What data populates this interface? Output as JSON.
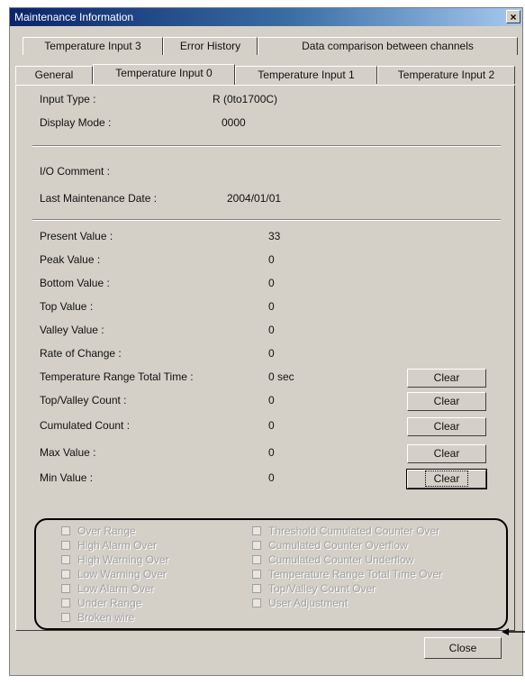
{
  "window": {
    "title": "Maintenance Information",
    "close_glyph": "×"
  },
  "tabs_back": [
    "Temperature Input 3",
    "Error History",
    "Data comparison between channels"
  ],
  "tabs_front": [
    "General",
    "Temperature Input 0",
    "Temperature Input 1",
    "Temperature Input 2"
  ],
  "active_tab": "Temperature Input 0",
  "info": {
    "input_type_label": "Input Type :",
    "input_type_value": "R (0to1700C)",
    "display_mode_label": "Display Mode :",
    "display_mode_value": "0000",
    "io_comment_label": "I/O Comment :",
    "last_maint_label": "Last Maintenance Date :",
    "last_maint_value": "2004/01/01"
  },
  "values": [
    {
      "label": "Present Value :",
      "value": "33"
    },
    {
      "label": "Peak Value :",
      "value": "0"
    },
    {
      "label": "Bottom Value :",
      "value": "0"
    },
    {
      "label": "Top Value :",
      "value": "0"
    },
    {
      "label": "Valley Value :",
      "value": "0"
    },
    {
      "label": "Rate of Change :",
      "value": "0"
    },
    {
      "label": "Temperature Range Total Time :",
      "value": "0 sec"
    },
    {
      "label": "Top/Valley Count :",
      "value": "0"
    },
    {
      "label": "Cumulated Count :",
      "value": "0"
    },
    {
      "label": "Max Value :",
      "value": "0"
    },
    {
      "label": "Min Value :",
      "value": "0"
    }
  ],
  "clear_label": "Clear",
  "flags_left": [
    "Over Range",
    "High Alarm Over",
    "High Warning Over",
    "Low Warning Over",
    "Low Alarm Over",
    "Under Range",
    "Broken wire"
  ],
  "flags_right": [
    "Threshold Cumulated Counter Over",
    "Cumulated Counter Overflow",
    "Cumulated Counter Underflow",
    "Temperature Range Total Time Over",
    "Top/Valley Count Over",
    "User Adjustment"
  ],
  "close_label": "Close"
}
